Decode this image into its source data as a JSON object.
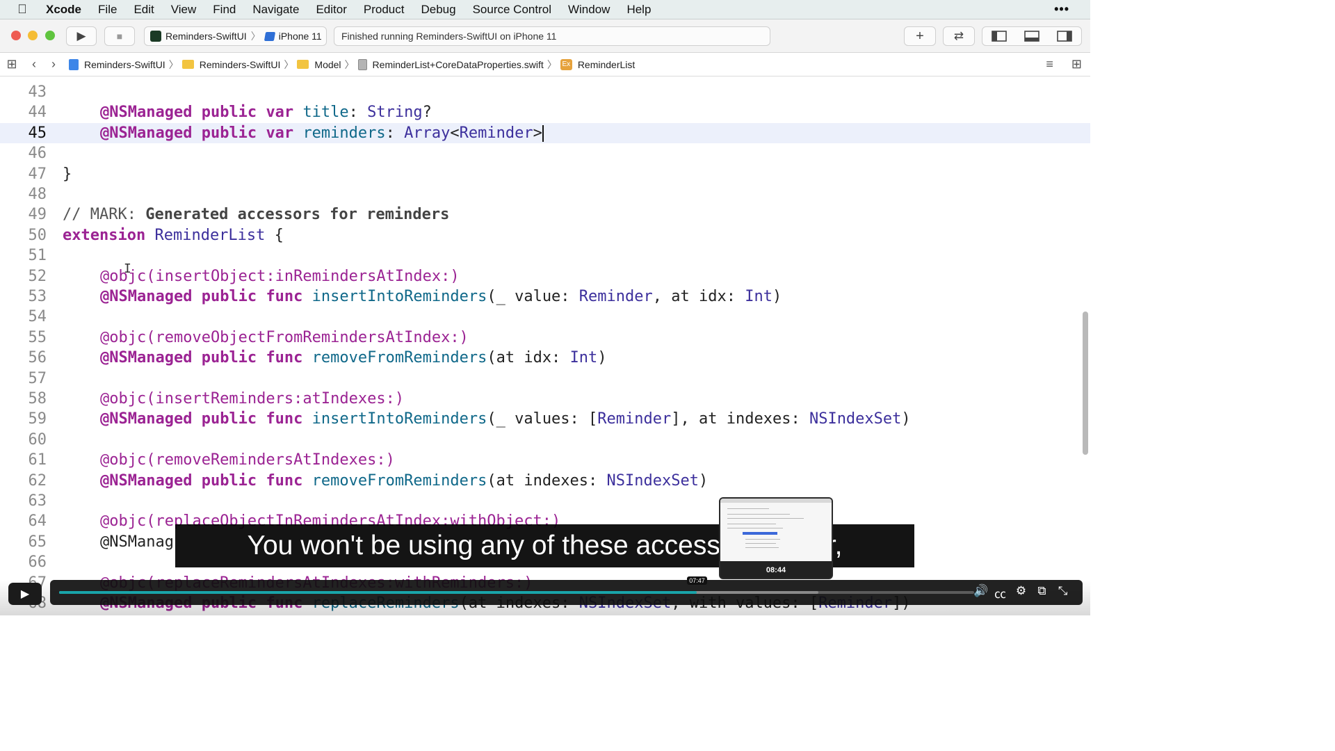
{
  "menubar": {
    "apple": "",
    "app": "Xcode",
    "items": [
      "File",
      "Edit",
      "View",
      "Find",
      "Navigate",
      "Editor",
      "Product",
      "Debug",
      "Source Control",
      "Window",
      "Help"
    ],
    "more": "•••"
  },
  "toolbar": {
    "run_icon": "▶",
    "stop_icon": "■",
    "scheme": "Reminders-SwiftUI",
    "separator": "〉",
    "device": "iPhone 11",
    "activity": "Finished running Reminders-SwiftUI on iPhone 11",
    "add_icon": "+",
    "swap_icon": "⇄"
  },
  "jumpbar": {
    "grid_icon": "⊞",
    "back_icon": "‹",
    "forward_icon": "›",
    "sep": "〉",
    "crumbs": [
      "Reminders-SwiftUI",
      "Reminders-SwiftUI",
      "Model",
      "ReminderList+CoreDataProperties.swift",
      "ReminderList"
    ],
    "ext_badge": "Ex",
    "lines_icon": "≡",
    "add_editor_icon": "⊞"
  },
  "editor": {
    "current_line": 45,
    "lines": [
      {
        "n": "43"
      },
      {
        "n": "44",
        "t": [
          "@NSManaged",
          " ",
          "public",
          " ",
          "var",
          " ",
          "title",
          ": ",
          "String",
          "?"
        ]
      },
      {
        "n": "45",
        "t": [
          "@NSManaged",
          " ",
          "public",
          " ",
          "var",
          " ",
          "reminders",
          ": ",
          "Array",
          "<",
          "Reminder",
          ">"
        ]
      },
      {
        "n": "46"
      },
      {
        "n": "47",
        "t": [
          "}"
        ]
      },
      {
        "n": "48"
      },
      {
        "n": "49",
        "t": [
          "// MARK: ",
          "Generated accessors for reminders"
        ]
      },
      {
        "n": "50",
        "t": [
          "extension",
          " ",
          "ReminderList",
          " {"
        ]
      },
      {
        "n": "51"
      },
      {
        "n": "52",
        "t": [
          "@objc(insertObject:inRemindersAtIndex:)"
        ]
      },
      {
        "n": "53",
        "t": [
          "@NSManaged",
          " ",
          "public",
          " ",
          "func",
          " ",
          "insertIntoReminders",
          "(_ value: ",
          "Reminder",
          ", at idx: ",
          "Int",
          ")"
        ]
      },
      {
        "n": "54"
      },
      {
        "n": "55",
        "t": [
          "@objc(removeObjectFromRemindersAtIndex:)"
        ]
      },
      {
        "n": "56",
        "t": [
          "@NSManaged",
          " ",
          "public",
          " ",
          "func",
          " ",
          "removeFromReminders",
          "(at idx: ",
          "Int",
          ")"
        ]
      },
      {
        "n": "57"
      },
      {
        "n": "58",
        "t": [
          "@objc(insertReminders:atIndexes:)"
        ]
      },
      {
        "n": "59",
        "t": [
          "@NSManaged",
          " ",
          "public",
          " ",
          "func",
          " ",
          "insertIntoReminders",
          "(_ values: [",
          "Reminder",
          "], at indexes: ",
          "NSIndexSet",
          ")"
        ]
      },
      {
        "n": "60"
      },
      {
        "n": "61",
        "t": [
          "@objc(removeRemindersAtIndexes:)"
        ]
      },
      {
        "n": "62",
        "t": [
          "@NSManaged",
          " ",
          "public",
          " ",
          "func",
          " ",
          "removeFromReminders",
          "(at indexes: ",
          "NSIndexSet",
          ")"
        ]
      },
      {
        "n": "63"
      },
      {
        "n": "64",
        "t": [
          "@objc(replaceObjectInRemindersAtIndex:withObject:)"
        ]
      },
      {
        "n": "65",
        "t": [
          "@NSManag"
        ]
      },
      {
        "n": "66"
      },
      {
        "n": "67",
        "t": [
          "@objc(replaceRemindersAtIndexes:withReminders:)"
        ]
      },
      {
        "n": "68",
        "t": [
          "@NSManaged",
          " ",
          "public",
          " ",
          "func",
          " ",
          "replaceReminders",
          "(at indexes: ",
          "NSIndexSet",
          ", with values: [",
          "Reminder",
          "])"
        ]
      }
    ]
  },
  "video": {
    "caption": "You won't be using any of these accessor r                either,",
    "preview_time": "08:44",
    "current_time": "07:47",
    "progress": 0.697,
    "buffered": 0.83,
    "play_icon": "▶",
    "volume_icon": "🔊",
    "cc_icon": "㏄",
    "settings_icon": "⚙",
    "pip_icon": "⧉",
    "fullscreen_icon": "⤡"
  }
}
